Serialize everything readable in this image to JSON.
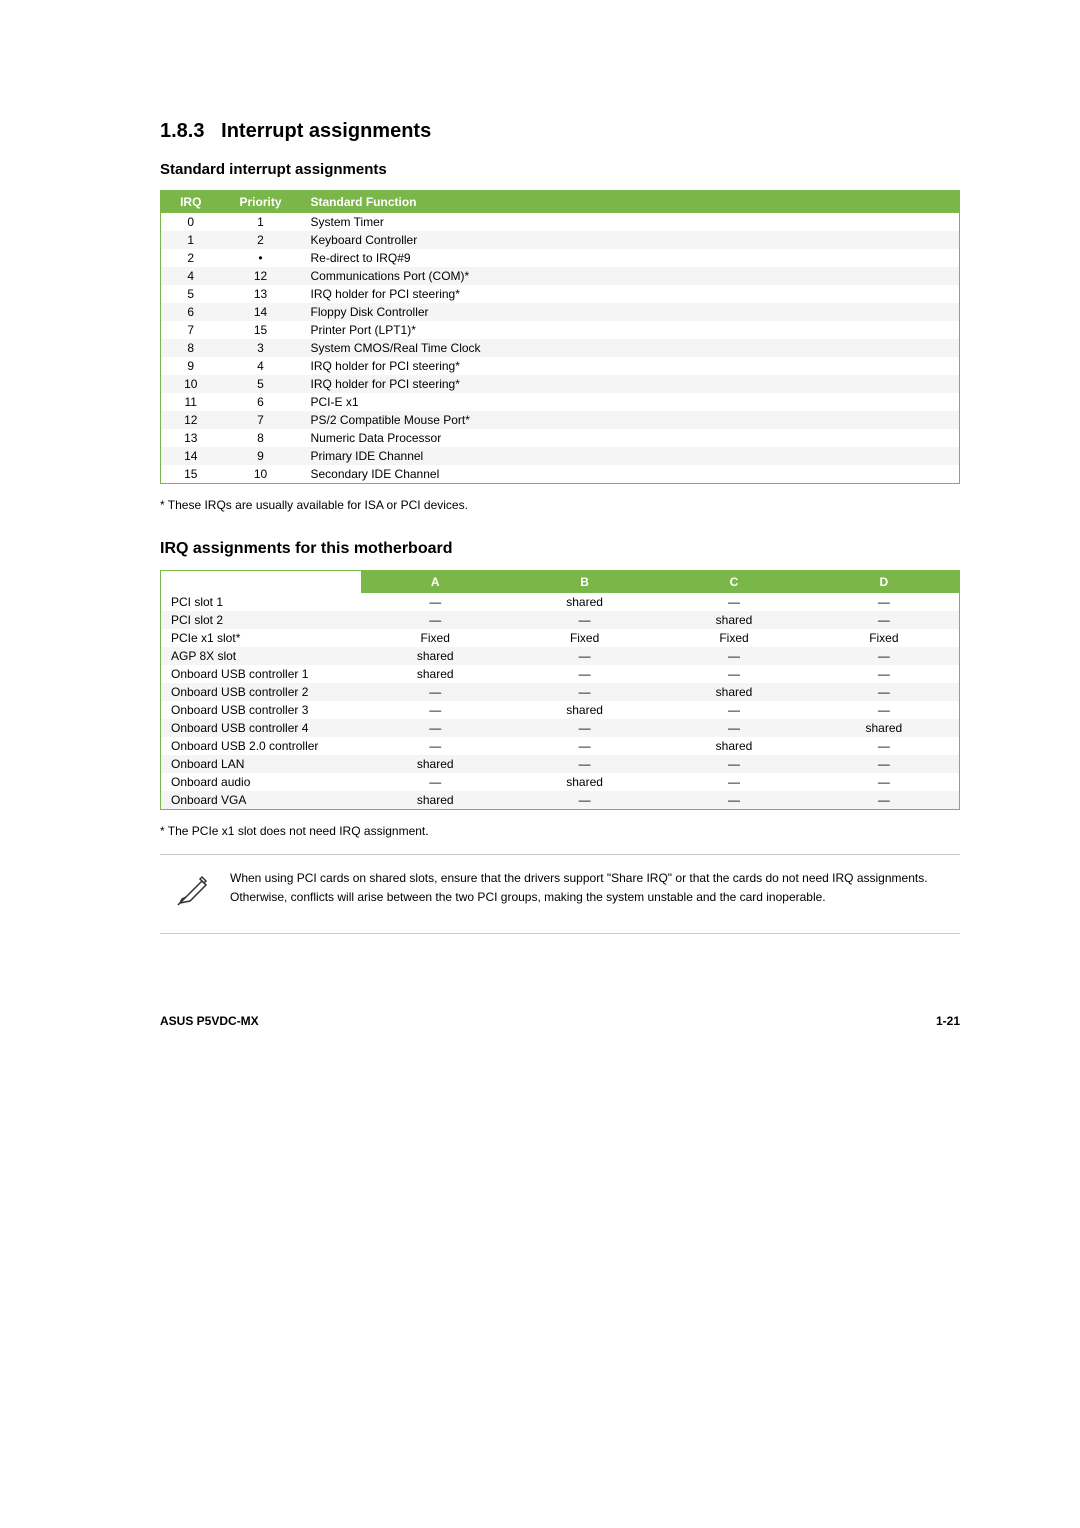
{
  "section": {
    "number": "1.8.3",
    "title": "Interrupt assignments"
  },
  "std_interrupt": {
    "subtitle": "Standard interrupt assignments",
    "table_headers": [
      "IRQ",
      "Priority",
      "Standard Function"
    ],
    "rows": [
      {
        "irq": "0",
        "priority": "1",
        "function": "System Timer"
      },
      {
        "irq": "1",
        "priority": "2",
        "function": "Keyboard Controller"
      },
      {
        "irq": "2",
        "priority": "•",
        "function": "Re-direct to IRQ#9"
      },
      {
        "irq": "4",
        "priority": "12",
        "function": "Communications Port (COM)*"
      },
      {
        "irq": "5",
        "priority": "13",
        "function": "IRQ holder for PCI steering*"
      },
      {
        "irq": "6",
        "priority": "14",
        "function": "Floppy Disk Controller"
      },
      {
        "irq": "7",
        "priority": "15",
        "function": "Printer Port (LPT1)*"
      },
      {
        "irq": "8",
        "priority": "3",
        "function": "System CMOS/Real Time Clock"
      },
      {
        "irq": "9",
        "priority": "4",
        "function": "IRQ holder for PCI steering*"
      },
      {
        "irq": "10",
        "priority": "5",
        "function": "IRQ holder for PCI steering*"
      },
      {
        "irq": "11",
        "priority": "6",
        "function": "PCI-E x1"
      },
      {
        "irq": "12",
        "priority": "7",
        "function": "PS/2 Compatible Mouse Port*"
      },
      {
        "irq": "13",
        "priority": "8",
        "function": "Numeric Data Processor"
      },
      {
        "irq": "14",
        "priority": "9",
        "function": "Primary IDE Channel"
      },
      {
        "irq": "15",
        "priority": "10",
        "function": "Secondary IDE Channel"
      }
    ],
    "footnote": "* These IRQs are usually available for ISA or PCI devices."
  },
  "irq_assignments": {
    "title": "IRQ assignments for this motherboard",
    "col_headers": [
      "",
      "A",
      "B",
      "C",
      "D"
    ],
    "rows": [
      {
        "device": "PCI slot 1",
        "a": "—",
        "b": "shared",
        "c": "—",
        "d": "—"
      },
      {
        "device": "PCI slot 2",
        "a": "—",
        "b": "—",
        "c": "shared",
        "d": "—"
      },
      {
        "device": "PCIe x1 slot*",
        "a": "Fixed",
        "b": "Fixed",
        "c": "Fixed",
        "d": "Fixed"
      },
      {
        "device": "AGP 8X slot",
        "a": "shared",
        "b": "—",
        "c": "—",
        "d": "—"
      },
      {
        "device": "Onboard USB controller 1",
        "a": "shared",
        "b": "—",
        "c": "—",
        "d": "—"
      },
      {
        "device": "Onboard USB controller 2",
        "a": "—",
        "b": "—",
        "c": "shared",
        "d": "—"
      },
      {
        "device": "Onboard USB controller 3",
        "a": "—",
        "b": "shared",
        "c": "—",
        "d": "—"
      },
      {
        "device": "Onboard USB controller 4",
        "a": "—",
        "b": "—",
        "c": "—",
        "d": "shared"
      },
      {
        "device": "Onboard USB 2.0 controller",
        "a": "—",
        "b": "—",
        "c": "shared",
        "d": "—"
      },
      {
        "device": "Onboard LAN",
        "a": "shared",
        "b": "—",
        "c": "—",
        "d": "—"
      },
      {
        "device": "Onboard audio",
        "a": "—",
        "b": "shared",
        "c": "—",
        "d": "—"
      },
      {
        "device": "Onboard VGA",
        "a": "shared",
        "b": "—",
        "c": "—",
        "d": "—"
      }
    ],
    "footnote": "* The PCIe x1 slot does not need IRQ assignment."
  },
  "note": {
    "text": "When using PCI cards on shared slots, ensure that the drivers support \"Share IRQ\" or that the cards do not need IRQ assignments. Otherwise, conflicts will arise between the two PCI groups, making the system unstable and the card inoperable."
  },
  "footer": {
    "model": "ASUS P5VDC-MX",
    "page": "1-21"
  }
}
